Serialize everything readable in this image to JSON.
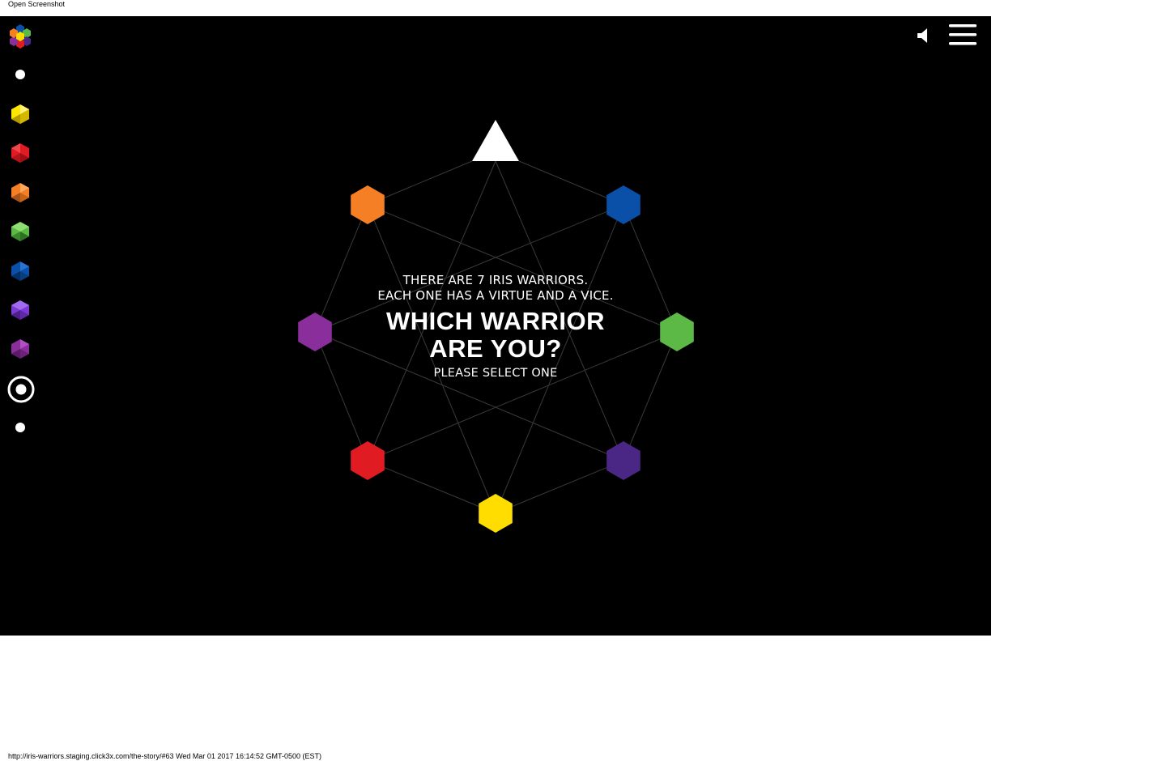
{
  "browser": {
    "caption": "Open Screenshot",
    "footer": "http://iris-warriors.staging.click3x.com/the-story/#63 Wed Mar 01 2017 16:14:52 GMT-0500 (EST)"
  },
  "colors": {
    "background": "#000000",
    "orange": "#f47f24",
    "blue": "#0a4fa8",
    "violet": "#8a2e9c",
    "green": "#5cb946",
    "red": "#e01b22",
    "purple": "#4a2685",
    "yellow": "#ffdd00",
    "line": "#3a3a3a",
    "white": "#ffffff"
  },
  "side_nav": {
    "items": [
      {
        "name": "nav-dot-top",
        "icon": "dot-icon"
      },
      {
        "name": "nav-yellow-warrior",
        "icon": "yellow-gem-icon",
        "color": "#ffe600"
      },
      {
        "name": "nav-red-warrior",
        "icon": "red-gem-icon",
        "color": "#e01b22"
      },
      {
        "name": "nav-orange-warrior",
        "icon": "orange-gem-icon",
        "color": "#f47f24"
      },
      {
        "name": "nav-green-warrior",
        "icon": "green-gem-icon",
        "color": "#5cb946"
      },
      {
        "name": "nav-blue-warrior",
        "icon": "blue-gem-icon",
        "color": "#0a4fa8"
      },
      {
        "name": "nav-violet-warrior",
        "icon": "violet-gem-icon",
        "color": "#7b3bd0"
      },
      {
        "name": "nav-purple-warrior",
        "icon": "purple-gem-icon",
        "color": "#8a2e9c"
      },
      {
        "name": "nav-target-current",
        "icon": "target-icon"
      },
      {
        "name": "nav-dot-bottom",
        "icon": "dot-icon"
      }
    ]
  },
  "header": {
    "sound_icon": "speaker-icon",
    "menu_icon": "hamburger-menu-icon"
  },
  "center": {
    "line1": "THERE ARE 7 IRIS WARRIORS.",
    "line2": "EACH ONE HAS A VIRTUE AND A VICE.",
    "headline1": "WHICH WARRIOR",
    "headline2": "ARE YOU?",
    "prompt": "PLEASE SELECT ONE"
  },
  "warriors": [
    {
      "name": "orange",
      "color": "#f47f24"
    },
    {
      "name": "blue",
      "color": "#0a4fa8"
    },
    {
      "name": "violet",
      "color": "#8a2e9c"
    },
    {
      "name": "green",
      "color": "#5cb946"
    },
    {
      "name": "red",
      "color": "#e01b22"
    },
    {
      "name": "purple",
      "color": "#4a2685"
    },
    {
      "name": "yellow",
      "color": "#ffdd00"
    }
  ]
}
